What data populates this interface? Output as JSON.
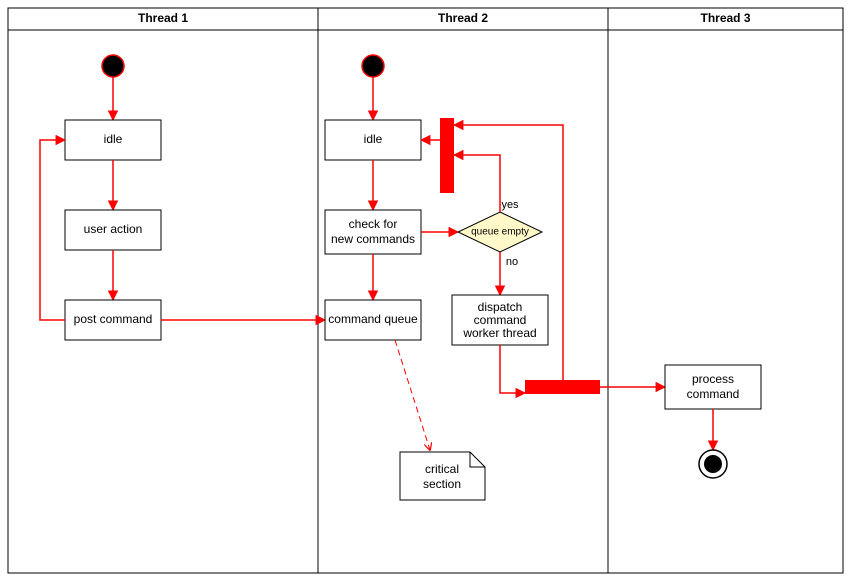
{
  "lanes": {
    "thread1": "Thread 1",
    "thread2": "Thread 2",
    "thread3": "Thread 3"
  },
  "thread1": {
    "idle": "idle",
    "user_action": "user action",
    "post_command": "post command"
  },
  "thread2": {
    "idle": "idle",
    "check_line1": "check for",
    "check_line2": "new commands",
    "queue": "command queue",
    "decision": "queue empty",
    "decision_yes": "yes",
    "decision_no": "no",
    "dispatch_line1": "dispatch",
    "dispatch_line2": "command",
    "dispatch_line3": "worker thread"
  },
  "thread3": {
    "process_line1": "process",
    "process_line2": "command"
  },
  "note": {
    "line1": "critical",
    "line2": "section"
  },
  "chart_data": {
    "type": "activity-diagram",
    "title": "",
    "swimlanes": [
      "Thread 1",
      "Thread 2",
      "Thread 3"
    ],
    "nodes": [
      {
        "id": "t1_start",
        "type": "initial",
        "lane": "Thread 1"
      },
      {
        "id": "t1_idle",
        "type": "activity",
        "lane": "Thread 1",
        "label": "idle"
      },
      {
        "id": "t1_user_action",
        "type": "activity",
        "lane": "Thread 1",
        "label": "user action"
      },
      {
        "id": "t1_post_command",
        "type": "activity",
        "lane": "Thread 1",
        "label": "post command"
      },
      {
        "id": "t2_start",
        "type": "initial",
        "lane": "Thread 2"
      },
      {
        "id": "t2_idle",
        "type": "activity",
        "lane": "Thread 2",
        "label": "idle"
      },
      {
        "id": "t2_check",
        "type": "activity",
        "lane": "Thread 2",
        "label": "check for new commands"
      },
      {
        "id": "t2_queue",
        "type": "activity",
        "lane": "Thread 2",
        "label": "command queue"
      },
      {
        "id": "t2_decision",
        "type": "decision",
        "lane": "Thread 2",
        "label": "queue empty"
      },
      {
        "id": "t2_dispatch",
        "type": "activity",
        "lane": "Thread 2",
        "label": "dispatch command worker thread"
      },
      {
        "id": "t2_bar_top",
        "type": "sync-bar",
        "lane": "Thread 2"
      },
      {
        "id": "t2_bar_bottom",
        "type": "sync-bar",
        "lane": "Thread 2"
      },
      {
        "id": "t3_process",
        "type": "activity",
        "lane": "Thread 3",
        "label": "process command"
      },
      {
        "id": "t3_end",
        "type": "final",
        "lane": "Thread 3"
      },
      {
        "id": "note_critical",
        "type": "note",
        "lane": "Thread 2",
        "label": "critical section"
      }
    ],
    "edges": [
      {
        "from": "t1_start",
        "to": "t1_idle"
      },
      {
        "from": "t1_idle",
        "to": "t1_user_action"
      },
      {
        "from": "t1_user_action",
        "to": "t1_post_command"
      },
      {
        "from": "t1_post_command",
        "to": "t1_idle"
      },
      {
        "from": "t1_post_command",
        "to": "t2_queue"
      },
      {
        "from": "t2_start",
        "to": "t2_idle"
      },
      {
        "from": "t2_idle",
        "to": "t2_check"
      },
      {
        "from": "t2_check",
        "to": "t2_decision"
      },
      {
        "from": "t2_check",
        "to": "t2_queue"
      },
      {
        "from": "t2_decision",
        "to": "t2_bar_top",
        "label": "yes"
      },
      {
        "from": "t2_decision",
        "to": "t2_dispatch",
        "label": "no"
      },
      {
        "from": "t2_bar_top",
        "to": "t2_idle"
      },
      {
        "from": "t2_dispatch",
        "to": "t2_bar_bottom"
      },
      {
        "from": "t2_bar_bottom",
        "to": "t2_bar_top"
      },
      {
        "from": "t2_bar_bottom",
        "to": "t3_process"
      },
      {
        "from": "t3_process",
        "to": "t3_end"
      },
      {
        "from": "t2_queue",
        "to": "note_critical",
        "style": "dashed"
      }
    ]
  }
}
